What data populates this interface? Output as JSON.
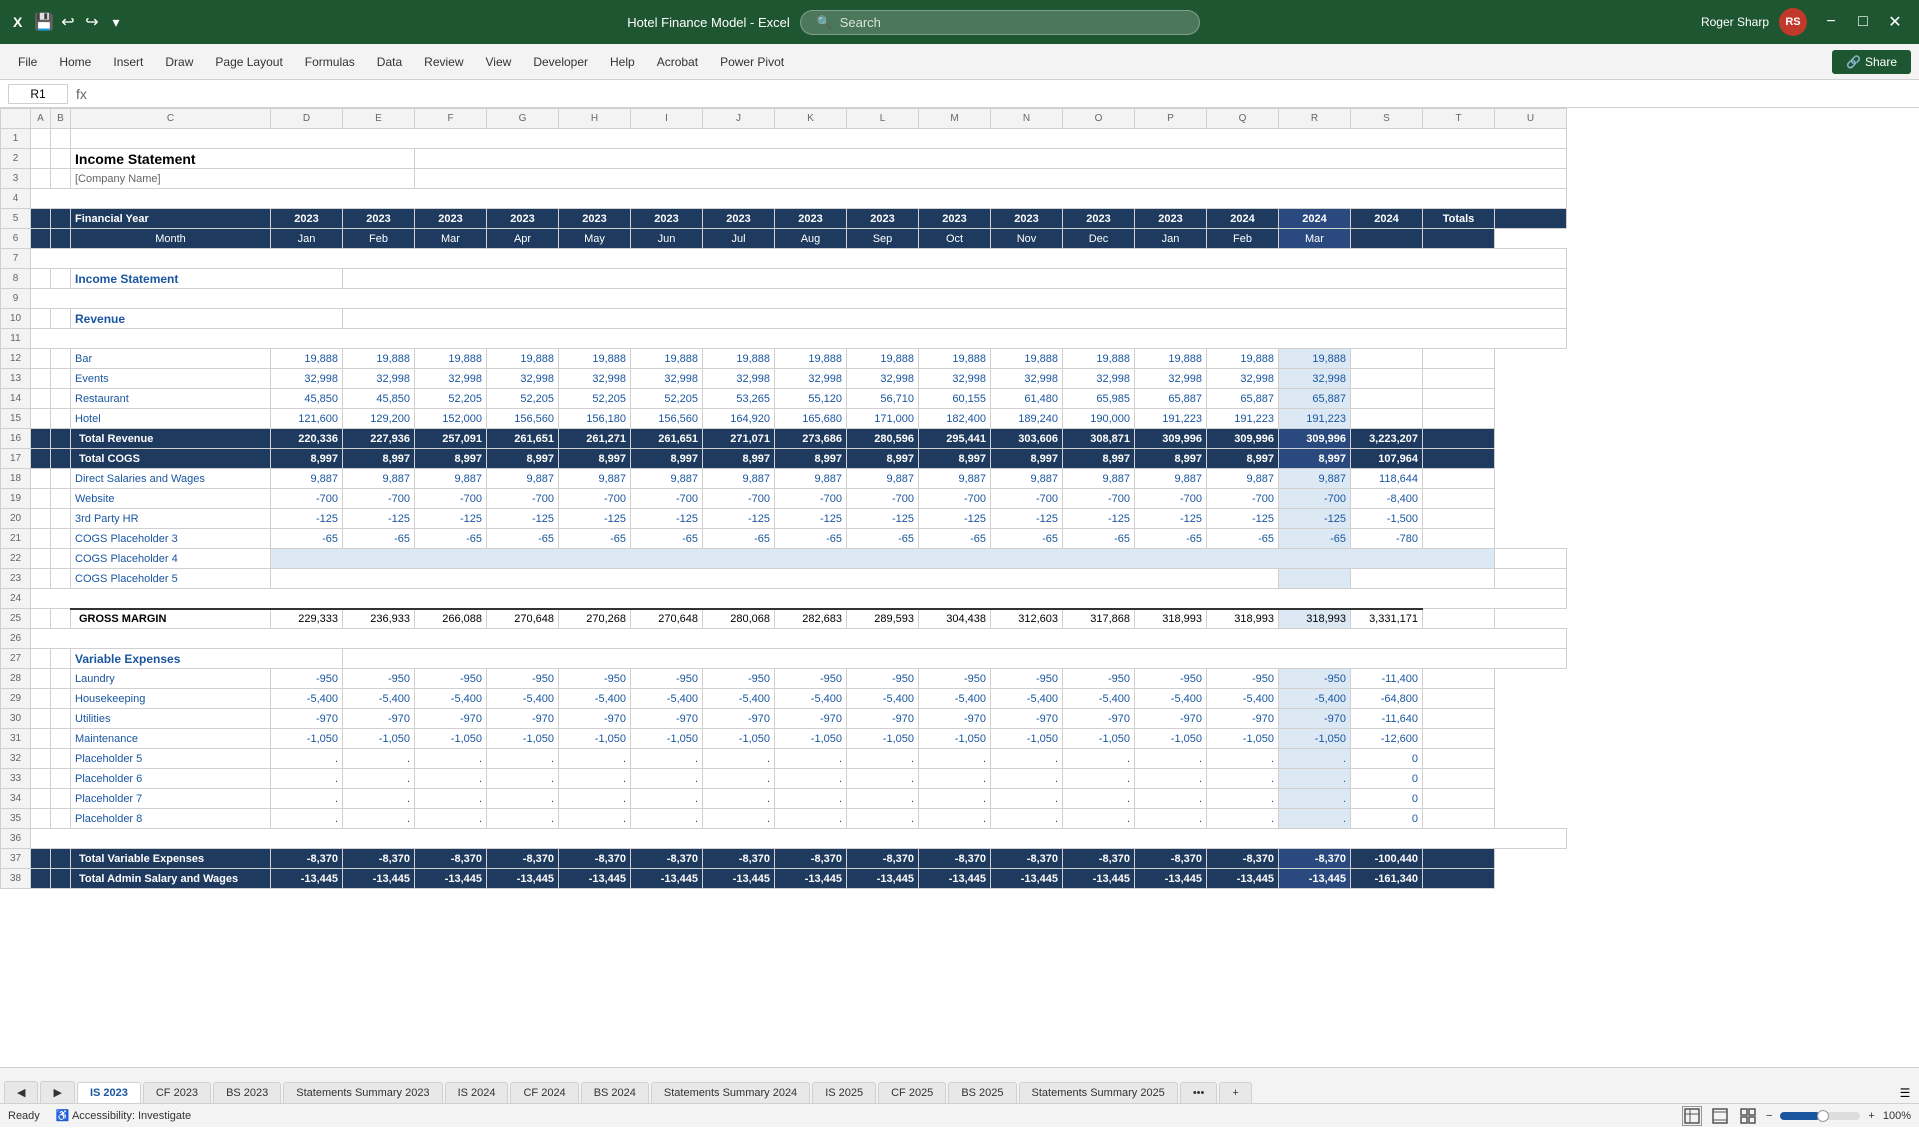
{
  "titleBar": {
    "appName": "Hotel Finance Model  -  Excel",
    "searchPlaceholder": "Search",
    "userName": "Roger Sharp",
    "userInitials": "RS"
  },
  "menuBar": {
    "items": [
      "File",
      "Home",
      "Insert",
      "Draw",
      "Page Layout",
      "Formulas",
      "Data",
      "Review",
      "View",
      "Developer",
      "Help",
      "Acrobat",
      "Power Pivot"
    ],
    "shareLabel": "Share"
  },
  "formulaBar": {
    "cellRef": "R1"
  },
  "sheet": {
    "title": "Income Statement",
    "subtitle": "[Company Name]",
    "columns": {
      "headers": [
        "Financial Year",
        "2023",
        "2023",
        "2023",
        "2023",
        "2023",
        "2023",
        "2023",
        "2023",
        "2023",
        "2023",
        "2023",
        "2023",
        "2024",
        "2024",
        "2024",
        "Totals"
      ],
      "months": [
        "",
        "Jan",
        "Feb",
        "Mar",
        "Apr",
        "May",
        "Jun",
        "Jul",
        "Aug",
        "Sep",
        "Oct",
        "Nov",
        "Dec",
        "Jan",
        "Feb",
        "Mar",
        ""
      ]
    },
    "sections": [
      {
        "type": "section-header",
        "label": "Income Statement"
      },
      {
        "type": "section-header",
        "label": "Revenue"
      },
      {
        "type": "data-row",
        "label": "Bar",
        "values": [
          "19,888",
          "19,888",
          "19,888",
          "19,888",
          "19,888",
          "19,888",
          "19,888",
          "19,888",
          "19,888",
          "19,888",
          "19,888",
          "19,888",
          "19,888",
          "19,888",
          "19,888",
          ""
        ]
      },
      {
        "type": "data-row",
        "label": "Events",
        "values": [
          "32,998",
          "32,998",
          "32,998",
          "32,998",
          "32,998",
          "32,998",
          "32,998",
          "32,998",
          "32,998",
          "32,998",
          "32,998",
          "32,998",
          "32,998",
          "32,998",
          "32,998",
          ""
        ]
      },
      {
        "type": "data-row",
        "label": "Restaurant",
        "values": [
          "45,850",
          "45,850",
          "52,205",
          "52,205",
          "52,205",
          "52,205",
          "53,265",
          "55,120",
          "56,710",
          "60,155",
          "61,480",
          "65,985",
          "65,887",
          "65,887",
          "65,887",
          ""
        ]
      },
      {
        "type": "data-row",
        "label": "Hotel",
        "values": [
          "121,600",
          "129,200",
          "152,000",
          "156,560",
          "156,180",
          "156,560",
          "164,920",
          "165,680",
          "171,000",
          "182,400",
          "189,240",
          "190,000",
          "191,223",
          "191,223",
          "191,223",
          ""
        ]
      },
      {
        "type": "total-row",
        "label": "Total Revenue",
        "values": [
          "220,336",
          "227,936",
          "257,091",
          "261,651",
          "261,271",
          "261,651",
          "271,071",
          "273,686",
          "280,596",
          "295,441",
          "303,606",
          "308,871",
          "309,996",
          "309,996",
          "309,996",
          "3,223,207"
        ]
      },
      {
        "type": "total-row",
        "label": "Total COGS",
        "values": [
          "8,997",
          "8,997",
          "8,997",
          "8,997",
          "8,997",
          "8,997",
          "8,997",
          "8,997",
          "8,997",
          "8,997",
          "8,997",
          "8,997",
          "8,997",
          "8,997",
          "8,997",
          "107,964"
        ]
      },
      {
        "type": "data-row",
        "label": "Direct Salaries and Wages",
        "values": [
          "9,887",
          "9,887",
          "9,887",
          "9,887",
          "9,887",
          "9,887",
          "9,887",
          "9,887",
          "9,887",
          "9,887",
          "9,887",
          "9,887",
          "9,887",
          "9,887",
          "9,887",
          "118,644"
        ]
      },
      {
        "type": "data-row",
        "label": "Website",
        "values": [
          "-700",
          "-700",
          "-700",
          "-700",
          "-700",
          "-700",
          "-700",
          "-700",
          "-700",
          "-700",
          "-700",
          "-700",
          "-700",
          "-700",
          "-700",
          "-8,400"
        ]
      },
      {
        "type": "data-row",
        "label": "3rd Party HR",
        "values": [
          "-125",
          "-125",
          "-125",
          "-125",
          "-125",
          "-125",
          "-125",
          "-125",
          "-125",
          "-125",
          "-125",
          "-125",
          "-125",
          "-125",
          "-125",
          "-1,500"
        ]
      },
      {
        "type": "data-row",
        "label": "COGS Placeholder 3",
        "values": [
          "-65",
          "-65",
          "-65",
          "-65",
          "-65",
          "-65",
          "-65",
          "-65",
          "-65",
          "-65",
          "-65",
          "-65",
          "-65",
          "-65",
          "-65",
          "-780"
        ]
      },
      {
        "type": "data-row",
        "label": "COGS Placeholder 4",
        "values": [
          "",
          "",
          "",
          "",
          "",
          "",
          "",
          "",
          "",
          "",
          "",
          "",
          "",
          "",
          "",
          ""
        ]
      },
      {
        "type": "data-row",
        "label": "COGS Placeholder 5",
        "values": [
          "",
          "",
          "",
          "",
          "",
          "",
          "",
          "",
          "",
          "",
          "",
          "",
          "",
          "",
          "",
          ""
        ]
      },
      {
        "type": "empty-row"
      },
      {
        "type": "gross-row",
        "label": "GROSS MARGIN",
        "values": [
          "229,333",
          "236,933",
          "266,088",
          "270,648",
          "270,268",
          "270,648",
          "280,068",
          "282,683",
          "289,593",
          "304,438",
          "312,603",
          "317,868",
          "318,993",
          "318,993",
          "318,993",
          "3,331,171"
        ]
      },
      {
        "type": "empty-row"
      },
      {
        "type": "section-header",
        "label": "Variable Expenses"
      },
      {
        "type": "data-row",
        "label": "Laundry",
        "values": [
          "-950",
          "-950",
          "-950",
          "-950",
          "-950",
          "-950",
          "-950",
          "-950",
          "-950",
          "-950",
          "-950",
          "-950",
          "-950",
          "-950",
          "-950",
          "-11,400"
        ]
      },
      {
        "type": "data-row",
        "label": "Housekeeping",
        "values": [
          "-5,400",
          "-5,400",
          "-5,400",
          "-5,400",
          "-5,400",
          "-5,400",
          "-5,400",
          "-5,400",
          "-5,400",
          "-5,400",
          "-5,400",
          "-5,400",
          "-5,400",
          "-5,400",
          "-5,400",
          "-64,800"
        ]
      },
      {
        "type": "data-row",
        "label": "Utilities",
        "values": [
          "-970",
          "-970",
          "-970",
          "-970",
          "-970",
          "-970",
          "-970",
          "-970",
          "-970",
          "-970",
          "-970",
          "-970",
          "-970",
          "-970",
          "-970",
          "-11,640"
        ]
      },
      {
        "type": "data-row",
        "label": "Maintenance",
        "values": [
          "-1,050",
          "-1,050",
          "-1,050",
          "-1,050",
          "-1,050",
          "-1,050",
          "-1,050",
          "-1,050",
          "-1,050",
          "-1,050",
          "-1,050",
          "-1,050",
          "-1,050",
          "-1,050",
          "-1,050",
          "-12,600"
        ]
      },
      {
        "type": "data-row",
        "label": "Placeholder 5",
        "values": [
          ".",
          ".",
          ".",
          ".",
          ".",
          ".",
          ".",
          ".",
          ".",
          ".",
          ".",
          ".",
          ".",
          ".",
          ".",
          "0"
        ]
      },
      {
        "type": "data-row",
        "label": "Placeholder 6",
        "values": [
          ".",
          ".",
          ".",
          ".",
          ".",
          ".",
          ".",
          ".",
          ".",
          ".",
          ".",
          ".",
          ".",
          ".",
          ".",
          "0"
        ]
      },
      {
        "type": "data-row",
        "label": "Placeholder 7",
        "values": [
          ".",
          ".",
          ".",
          ".",
          ".",
          ".",
          ".",
          ".",
          ".",
          ".",
          ".",
          ".",
          ".",
          ".",
          ".",
          "0"
        ]
      },
      {
        "type": "data-row",
        "label": "Placeholder 8",
        "values": [
          ".",
          ".",
          ".",
          ".",
          ".",
          ".",
          ".",
          ".",
          ".",
          ".",
          ".",
          ".",
          ".",
          ".",
          ".",
          "0"
        ]
      },
      {
        "type": "empty-row"
      },
      {
        "type": "total-row",
        "label": "Total Variable Expenses",
        "values": [
          "-8,370",
          "-8,370",
          "-8,370",
          "-8,370",
          "-8,370",
          "-8,370",
          "-8,370",
          "-8,370",
          "-8,370",
          "-8,370",
          "-8,370",
          "-8,370",
          "-8,370",
          "-8,370",
          "-8,370",
          "-100,440"
        ]
      },
      {
        "type": "total-row",
        "label": "Total Admin Salary and Wages",
        "values": [
          "-13,445",
          "-13,445",
          "-13,445",
          "-13,445",
          "-13,445",
          "-13,445",
          "-13,445",
          "-13,445",
          "-13,445",
          "-13,445",
          "-13,445",
          "-13,445",
          "-13,445",
          "-13,445",
          "-13,445",
          "-161,340"
        ]
      }
    ]
  },
  "tabs": {
    "items": [
      "IS 2023",
      "CF 2023",
      "BS 2023",
      "Statements Summary 2023",
      "IS 2024",
      "CF 2024",
      "BS 2024",
      "Statements Summary 2024",
      "IS 2025",
      "CF 2025",
      "BS 2025",
      "Statements Summary 2025"
    ],
    "activeIndex": 0
  },
  "statusBar": {
    "ready": "Ready",
    "accessibility": "Accessibility: Investigate",
    "zoom": "100%"
  }
}
